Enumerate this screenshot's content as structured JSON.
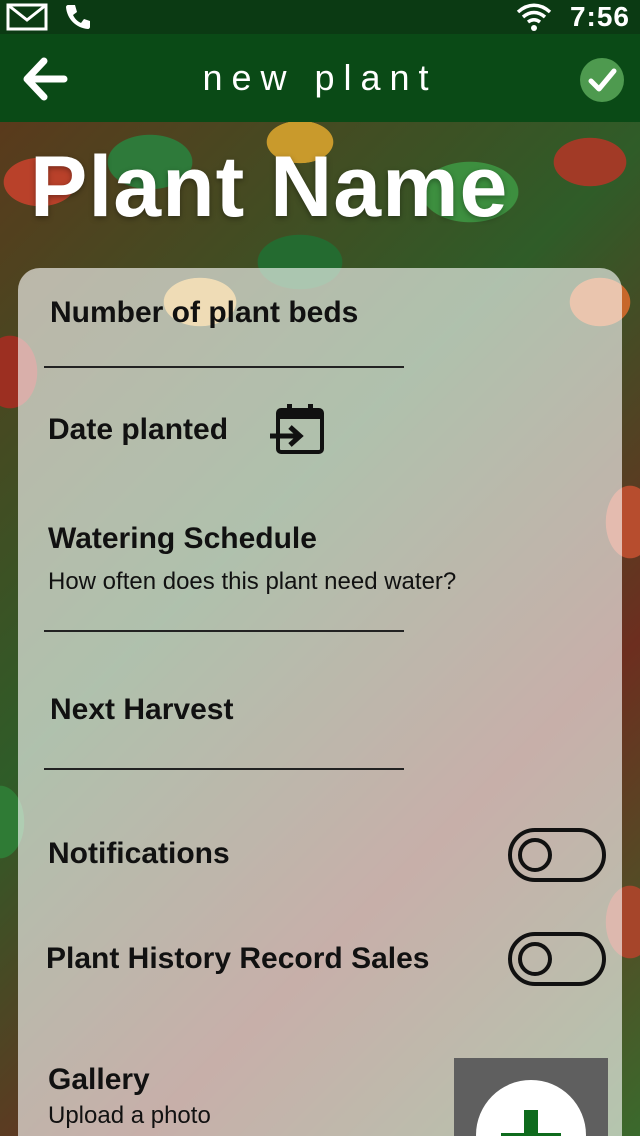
{
  "status_bar": {
    "time": "7:56"
  },
  "app_bar": {
    "title": "new plant"
  },
  "header": {
    "plant_name": "Plant Name"
  },
  "form": {
    "plant_beds_label": "Number of plant beds",
    "date_planted_label": "Date planted",
    "watering_label": "Watering Schedule",
    "watering_hint": "How often does this plant need water?",
    "next_harvest_label": "Next Harvest",
    "notifications_label": "Notifications",
    "notifications_on": false,
    "history_label": "Plant History Record Sales",
    "history_on": false,
    "gallery_label": "Gallery",
    "gallery_hint": "Upload a photo"
  },
  "colors": {
    "status_bar": "#0b3a13",
    "app_bar": "#0a4a16",
    "accent": "#4e9a4f",
    "plus": "#0e6b1d"
  }
}
